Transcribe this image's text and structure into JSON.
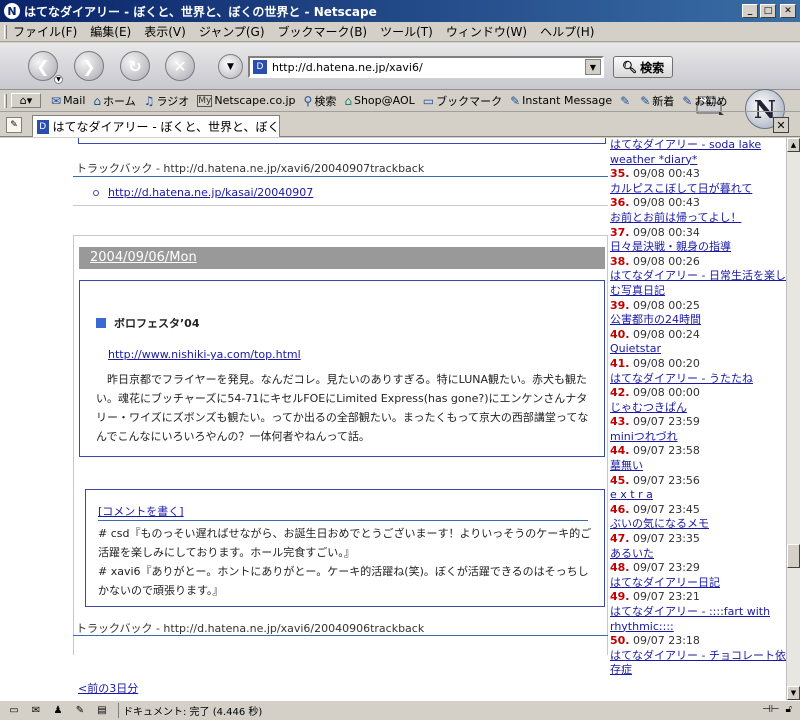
{
  "window": {
    "title": "はてなダイアリー - ぼくと、世界と、ぼくの世界と - Netscape",
    "app_icon": "netscape-icon"
  },
  "menu": [
    "ファイル(F)",
    "編集(E)",
    "表示(V)",
    "ジャンプ(G)",
    "ブックマーク(B)",
    "ツール(T)",
    "ウィンドウ(W)",
    "ヘルプ(H)"
  ],
  "nav": {
    "url": "http://d.hatena.ne.jp/xavi6/",
    "search_label": "検索"
  },
  "personal_toolbar": [
    {
      "icon": "mail-icon",
      "label": "Mail"
    },
    {
      "icon": "home-icon",
      "label": "ホーム"
    },
    {
      "icon": "radio-icon",
      "label": "ラジオ"
    },
    {
      "icon": "my-icon",
      "label": "Netscape.co.jp"
    },
    {
      "icon": "search-icon",
      "label": "検索"
    },
    {
      "icon": "shop-icon",
      "label": "Shop@AOL"
    },
    {
      "icon": "bookmark-icon",
      "label": "ブックマーク"
    },
    {
      "icon": "im-icon",
      "label": "Instant Message"
    },
    {
      "icon": "link-icon",
      "label": ""
    },
    {
      "icon": "link-icon",
      "label": "新着"
    },
    {
      "icon": "link-icon",
      "label": "お勧め"
    }
  ],
  "tab": {
    "title": "はてなダイアリー - ぼくと、世界と、ぼくの世界と"
  },
  "content": {
    "trackback1": "トラックバック - http://d.hatena.ne.jp/xavi6/20040907trackback",
    "trackback1_link": "http://d.hatena.ne.jp/kasai/20040907",
    "date": "2004/09/06/Mon",
    "entry_title": "ボロフェスタ’04",
    "entry_url": "http://www.nishiki-ya.com/top.html",
    "entry_body": "　昨日京都でフライヤーを発見。なんだコレ。見たいのありすぎる。特にLUNA観たい。赤犬も観たい。魂花にブッチャーズに54-71にキセルFOEにLimited Express(has gone?)にエンケンさんナタリー・ワイズにズボンズも観たい。ってか出るの全部観たい。まったくもって京大の西部講堂ってなんでこんなにいろいろやんの？一体何者やねんって話。",
    "comment_write": "[コメントを書く]",
    "comments": [
      "# csd『ものっそい遅ればせながら、お誕生日おめでとうございまーす！よりいっそうのケーキ的ご活躍を楽しみにしております。ホール完食すごい。』",
      "# xavi6『ありがとー。ホントにありがとー。ケーキ的活躍ね(笑)。ぼくが活躍できるのはそっちしかないので頑張ります。』"
    ],
    "trackback2": "トラックバック - http://d.hatena.ne.jp/xavi6/20040906trackback",
    "prev_link": "<前の3日分"
  },
  "rightlist": [
    {
      "rank": "",
      "time": "",
      "title": "はてなダイアリー - soda lake weather *diary*"
    },
    {
      "rank": "35.",
      "time": " 09/08 00:43",
      "title": "カルピスこぼして日が暮れて"
    },
    {
      "rank": "36.",
      "time": " 09/08 00:43",
      "title": "お前とお前は帰ってよし！"
    },
    {
      "rank": "37.",
      "time": " 09/08 00:34",
      "title": "日々是決戦・親身の指導"
    },
    {
      "rank": "38.",
      "time": " 09/08 00:26",
      "title": "はてなダイアリー - 日常生活を楽しむ写真日記"
    },
    {
      "rank": "39.",
      "time": " 09/08 00:25",
      "title": "公害都市の24時間"
    },
    {
      "rank": "40.",
      "time": " 09/08 00:24",
      "title": "Quietstar"
    },
    {
      "rank": "41.",
      "time": " 09/08 00:20",
      "title": "はてなダイアリー - うたたね"
    },
    {
      "rank": "42.",
      "time": " 09/08 00:00",
      "title": "じゃむつきぱん"
    },
    {
      "rank": "43.",
      "time": " 09/07 23:59",
      "title": "miniつれづれ"
    },
    {
      "rank": "44.",
      "time": " 09/07 23:58",
      "title": "墓無い"
    },
    {
      "rank": "45.",
      "time": " 09/07 23:56",
      "title": "e x t r a"
    },
    {
      "rank": "46.",
      "time": " 09/07 23:45",
      "title": "ぶいの気になるメモ"
    },
    {
      "rank": "47.",
      "time": " 09/07 23:35",
      "title": "あるいた"
    },
    {
      "rank": "48.",
      "time": " 09/07 23:29",
      "title": "はてなダイアリー日記"
    },
    {
      "rank": "49.",
      "time": " 09/07 23:21",
      "title": "はてなダイアリー - ::::fart with rhythmic::::"
    },
    {
      "rank": "50.",
      "time": " 09/07 23:18",
      "title": "はてなダイアリー - チョコレート依存症"
    }
  ],
  "status": {
    "text": "ドキュメント: 完了 (4.446 秒)"
  }
}
